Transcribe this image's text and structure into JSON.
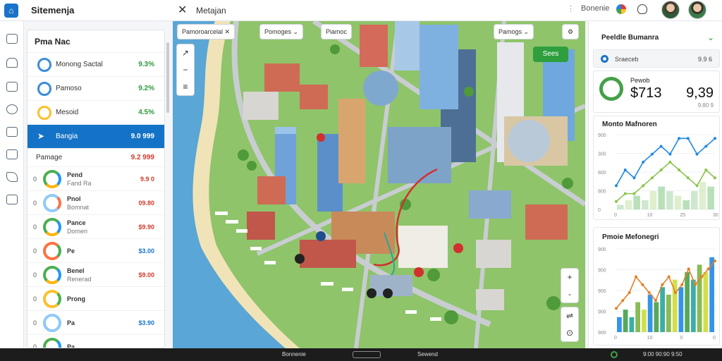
{
  "app": {
    "title": "Sitemenja",
    "map_title": "Metajan"
  },
  "top_right": {
    "label": "Bonenie"
  },
  "panel": {
    "title": "Pma Nac",
    "places": [
      {
        "label": "Monong Sactal",
        "value": "9.3%"
      },
      {
        "label": "Pamoso",
        "value": "9.2%"
      },
      {
        "label": "Mesoid",
        "value": "4.5%"
      },
      {
        "label": "Bangia",
        "value": "9.0 999",
        "active": true
      },
      {
        "label": "Pamage",
        "value": "9.2 999"
      }
    ],
    "subitems": [
      {
        "num": "0",
        "t1": "Pend",
        "t2": "Fand Ra",
        "value": "9.9 0"
      },
      {
        "num": "0",
        "t1": "Pnol",
        "t2": "Bomnat",
        "value": "09.80"
      },
      {
        "num": "0",
        "t1": "Pance",
        "t2": "Domeri",
        "value": "$9.90"
      },
      {
        "num": "0",
        "t1": "Pe",
        "t2": "",
        "value": "$3.00"
      },
      {
        "num": "0",
        "t1": "Benel",
        "t2": "Renerad",
        "value": "$9.00"
      },
      {
        "num": "0",
        "t1": "Prong",
        "t2": "",
        "value": ""
      },
      {
        "num": "0",
        "t1": "Pa",
        "t2": "",
        "value": "$3.90"
      },
      {
        "num": "0",
        "t1": "Pa",
        "t2": "",
        "value": ""
      }
    ]
  },
  "map": {
    "chips": [
      "Pamoroarcelal",
      "Pomoges",
      "Piamoc",
      "Pamogs"
    ],
    "green_button": "Sees",
    "tools": [
      "+",
      "-"
    ]
  },
  "dash": {
    "summary_title": "Peeldle Bumanra",
    "search_label": "Sraeceb",
    "search_value": "9.9 6",
    "kpi_title": "Pewob",
    "kpi_left": "$713",
    "kpi_right": "9,39",
    "kpi_right_sub": "9.80 9",
    "chart1_title": "Monto Mafnoren",
    "chart2_title": "Pmoie Mefonegri"
  },
  "chart_data": [
    {
      "type": "line",
      "title": "Monto Mafnoren",
      "y_ticks": [
        "900",
        "300",
        "800",
        "800",
        "0"
      ],
      "x_ticks": [
        "0",
        "10",
        "25",
        "30"
      ],
      "series": [
        {
          "values": [
            3,
            5,
            4,
            6,
            7,
            8,
            7,
            9,
            9,
            7,
            8,
            9
          ]
        },
        {
          "values": [
            1,
            2,
            2,
            3,
            4,
            5,
            6,
            5,
            4,
            3,
            5,
            4
          ]
        }
      ],
      "bars": [
        1,
        2,
        3,
        2,
        4,
        5,
        4,
        3,
        2,
        4,
        6,
        5
      ]
    },
    {
      "type": "bar",
      "title": "Pmoie Mefonegri",
      "y_ticks": [
        "900",
        "900",
        "900",
        "900",
        "900"
      ],
      "x_ticks": [
        "0",
        "10",
        "0",
        "0"
      ],
      "bars": [
        2,
        3,
        2,
        4,
        3,
        5,
        4,
        6,
        5,
        7,
        6,
        8,
        7,
        9,
        8,
        10
      ],
      "line": [
        3,
        4,
        5,
        7,
        6,
        5,
        4,
        6,
        7,
        5,
        6,
        8,
        6,
        7,
        8,
        9
      ]
    }
  ],
  "taskbar": {
    "left": "Bonnenie",
    "mid": "Sewend",
    "right": "9:00 90:90 9:50"
  }
}
